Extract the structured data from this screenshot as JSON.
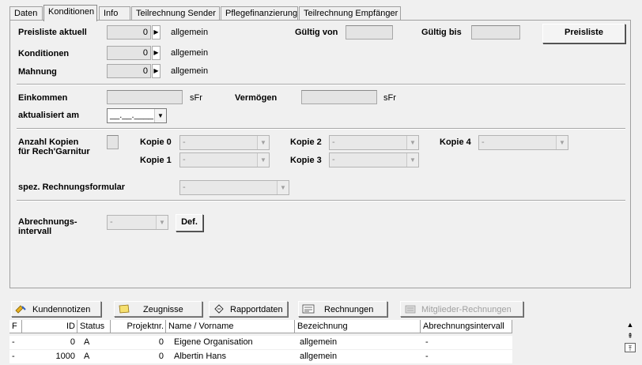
{
  "tabs": [
    "Daten",
    "Konditionen",
    "Info",
    "Teilrechnung Sender",
    "Pflegefinanzierung",
    "Teilrechnung Empfänger"
  ],
  "active_tab": "Konditionen",
  "preisliste": {
    "label": "Preisliste aktuell",
    "value": "0",
    "text": "allgemein"
  },
  "gueltig_von": {
    "label": "Gültig von"
  },
  "gueltig_bis": {
    "label": "Gültig bis"
  },
  "preisliste_button": "Preisliste",
  "konditionen": {
    "label": "Konditionen",
    "value": "0",
    "text": "allgemein"
  },
  "mahnung": {
    "label": "Mahnung",
    "value": "0",
    "text": "allgemein"
  },
  "einkommen": {
    "label": "Einkommen",
    "unit": "sFr"
  },
  "vermoegen": {
    "label": "Vermögen",
    "unit": "sFr"
  },
  "aktualisiert": {
    "label": "aktualisiert am",
    "value": "__.__.____"
  },
  "anzahl_kopien": {
    "label_line1": "Anzahl Kopien",
    "label_line2": "für Rech'Garnitur"
  },
  "kopien": [
    {
      "label": "Kopie 0",
      "value": "-"
    },
    {
      "label": "Kopie 1",
      "value": "-"
    },
    {
      "label": "Kopie 2",
      "value": "-"
    },
    {
      "label": "Kopie 3",
      "value": "-"
    },
    {
      "label": "Kopie 4",
      "value": "-"
    }
  ],
  "spez_rechnungsformular": {
    "label": "spez. Rechnungsformular",
    "value": "-"
  },
  "abrechnungsintervall": {
    "label_line1": "Abrechnungs-",
    "label_line2": "intervall",
    "value": "-",
    "button": "Def."
  },
  "toolbar": {
    "kundennotizen": "Kundennotizen",
    "zeugnisse": "Zeugnisse",
    "rapportdaten": "Rapportdaten",
    "rechnungen": "Rechnungen",
    "mitglieder_rechnungen": "Mitglieder-Rechnungen"
  },
  "table": {
    "columns": [
      "F",
      "ID",
      "Status",
      "Projektnr.",
      "Name / Vorname",
      "Bezeichnung",
      "Abrechnungsintervall"
    ],
    "rows": [
      [
        "-",
        "0",
        "A",
        "0",
        "Eigene Organisation",
        "allgemein",
        "-"
      ],
      [
        "-",
        "1000",
        "A",
        "0",
        "Albertin Hans",
        "allgemein",
        "-"
      ]
    ]
  },
  "colors": {
    "panel_bg": "#f0f0f0",
    "field_bg": "#e4e4e4",
    "row_bg": "#ffffff"
  }
}
